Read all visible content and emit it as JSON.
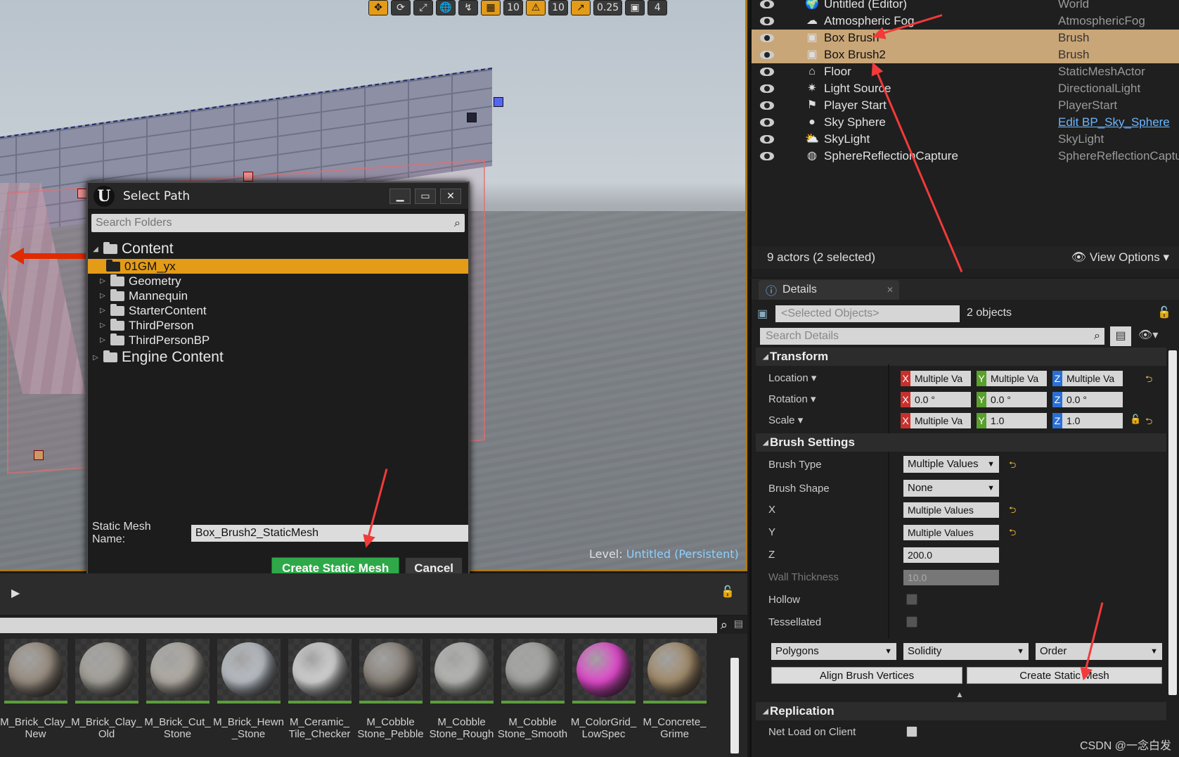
{
  "viewport": {
    "toolbar": [
      "✥",
      "⟳",
      "⤢",
      "🌐",
      "↯",
      "▦",
      "10",
      "⚠",
      "10",
      "↗",
      "0.25",
      "▣",
      "4"
    ],
    "level_prefix": "Level:",
    "level_name": "Untitled (Persistent)"
  },
  "dialog": {
    "title": "Select Path",
    "search_placeholder": "Search Folders",
    "tree": [
      {
        "label": "Content",
        "level": 0,
        "expanded": true
      },
      {
        "label": "01GM_yx",
        "level": 1,
        "selected": true
      },
      {
        "label": "Geometry",
        "level": 1
      },
      {
        "label": "Mannequin",
        "level": 1
      },
      {
        "label": "StarterContent",
        "level": 1
      },
      {
        "label": "ThirdPerson",
        "level": 1
      },
      {
        "label": "ThirdPersonBP",
        "level": 1
      },
      {
        "label": "Engine Content",
        "level": 0
      }
    ],
    "mesh_name_label": "Static Mesh Name:",
    "mesh_name_value": "Box_Brush2_StaticMesh",
    "create_label": "Create Static Mesh",
    "cancel_label": "Cancel"
  },
  "content_browser": {
    "assets": [
      {
        "name": "M_Brick_Clay_New",
        "line1": "M_Brick_Clay_",
        "line2": "New",
        "color": "#9b8f82"
      },
      {
        "name": "M_Brick_Clay_Old",
        "line1": "M_Brick_Clay_",
        "line2": "Old",
        "color": "#a7a39c"
      },
      {
        "name": "M_Brick_Cut_Stone",
        "line1": "M_Brick_Cut_",
        "line2": "Stone",
        "color": "#b3aea6"
      },
      {
        "name": "M_Brick_Hewn_Stone",
        "line1": "M_Brick_Hewn",
        "line2": "_Stone",
        "color": "#bcc2c9"
      },
      {
        "name": "M_Ceramic_Tile_Checker",
        "line1": "M_Ceramic_",
        "line2": "Tile_Checker",
        "color": "#d7d7d7"
      },
      {
        "name": "M_Cobble Stone_Pebble",
        "line1": "M_Cobble",
        "line2": "Stone_Pebble",
        "color": "#8c847c"
      },
      {
        "name": "M_Cobble Stone_Rough",
        "line1": "M_Cobble",
        "line2": "Stone_Rough",
        "color": "#b9b9b6"
      },
      {
        "name": "M_Cobble Stone_Smooth",
        "line1": "M_Cobble",
        "line2": "Stone_Smooth",
        "color": "#a6a6a3"
      },
      {
        "name": "M_ColorGrid_LowSpec",
        "line1": "M_ColorGrid_",
        "line2": "LowSpec",
        "color": "#e64bd0"
      },
      {
        "name": "M_Concrete_Grime",
        "line1": "M_Concrete_",
        "line2": "Grime",
        "color": "#a58e6d"
      }
    ]
  },
  "outliner": {
    "rows": [
      {
        "name": "Untitled (Editor)",
        "type": "World",
        "icon": "world"
      },
      {
        "name": "Atmospheric Fog",
        "type": "AtmosphericFog",
        "icon": "fog"
      },
      {
        "name": "Box Brush",
        "type": "Brush",
        "icon": "brush",
        "selected": true
      },
      {
        "name": "Box Brush2",
        "type": "Brush",
        "icon": "brush",
        "selected": true
      },
      {
        "name": "Floor",
        "type": "StaticMeshActor",
        "icon": "mesh"
      },
      {
        "name": "Light Source",
        "type": "DirectionalLight",
        "icon": "light"
      },
      {
        "name": "Player Start",
        "type": "PlayerStart",
        "icon": "player"
      },
      {
        "name": "Sky Sphere",
        "type": "Edit BP_Sky_Sphere",
        "icon": "sphere",
        "link": true
      },
      {
        "name": "SkyLight",
        "type": "SkyLight",
        "icon": "skylight"
      },
      {
        "name": "SphereReflectionCapture",
        "type": "SphereReflectionCaptu",
        "icon": "reflect"
      }
    ],
    "count_text": "9 actors (2 selected)",
    "view_options": "View Options"
  },
  "details": {
    "tab_label": "Details",
    "selected_objects": "<Selected Objects>",
    "objects_count": "2 objects",
    "search_placeholder": "Search Details",
    "transform_label": "Transform",
    "location_label": "Location",
    "rotation_label": "Rotation",
    "scale_label": "Scale",
    "location": [
      "Multiple Va",
      "Multiple Va",
      "Multiple Va"
    ],
    "rotation": [
      "0.0 °",
      "0.0 °",
      "0.0 °"
    ],
    "scale": [
      "Multiple Va",
      "1.0",
      "1.0"
    ],
    "brush_settings_label": "Brush Settings",
    "brush_type_label": "Brush Type",
    "brush_type_value": "Multiple Values",
    "brush_shape_label": "Brush Shape",
    "brush_shape_value": "None",
    "x_label": "X",
    "x_value": "Multiple Values",
    "y_label": "Y",
    "y_value": "Multiple Values",
    "z_label": "Z",
    "z_value": "200.0",
    "wall_thickness_label": "Wall Thickness",
    "wall_thickness_value": "10.0",
    "hollow_label": "Hollow",
    "tessellated_label": "Tessellated",
    "polygons_label": "Polygons",
    "solidity_label": "Solidity",
    "order_label": "Order",
    "align_label": "Align Brush Vertices",
    "create_label": "Create Static Mesh",
    "replication_label": "Replication",
    "net_load_label": "Net Load on Client"
  },
  "watermark": "CSDN @一念白发",
  "colors": {
    "selection": "#e39b18",
    "outliner_selection": "#c9a677",
    "create_button": "#2fa84a",
    "arrow": "#f23a3a"
  }
}
